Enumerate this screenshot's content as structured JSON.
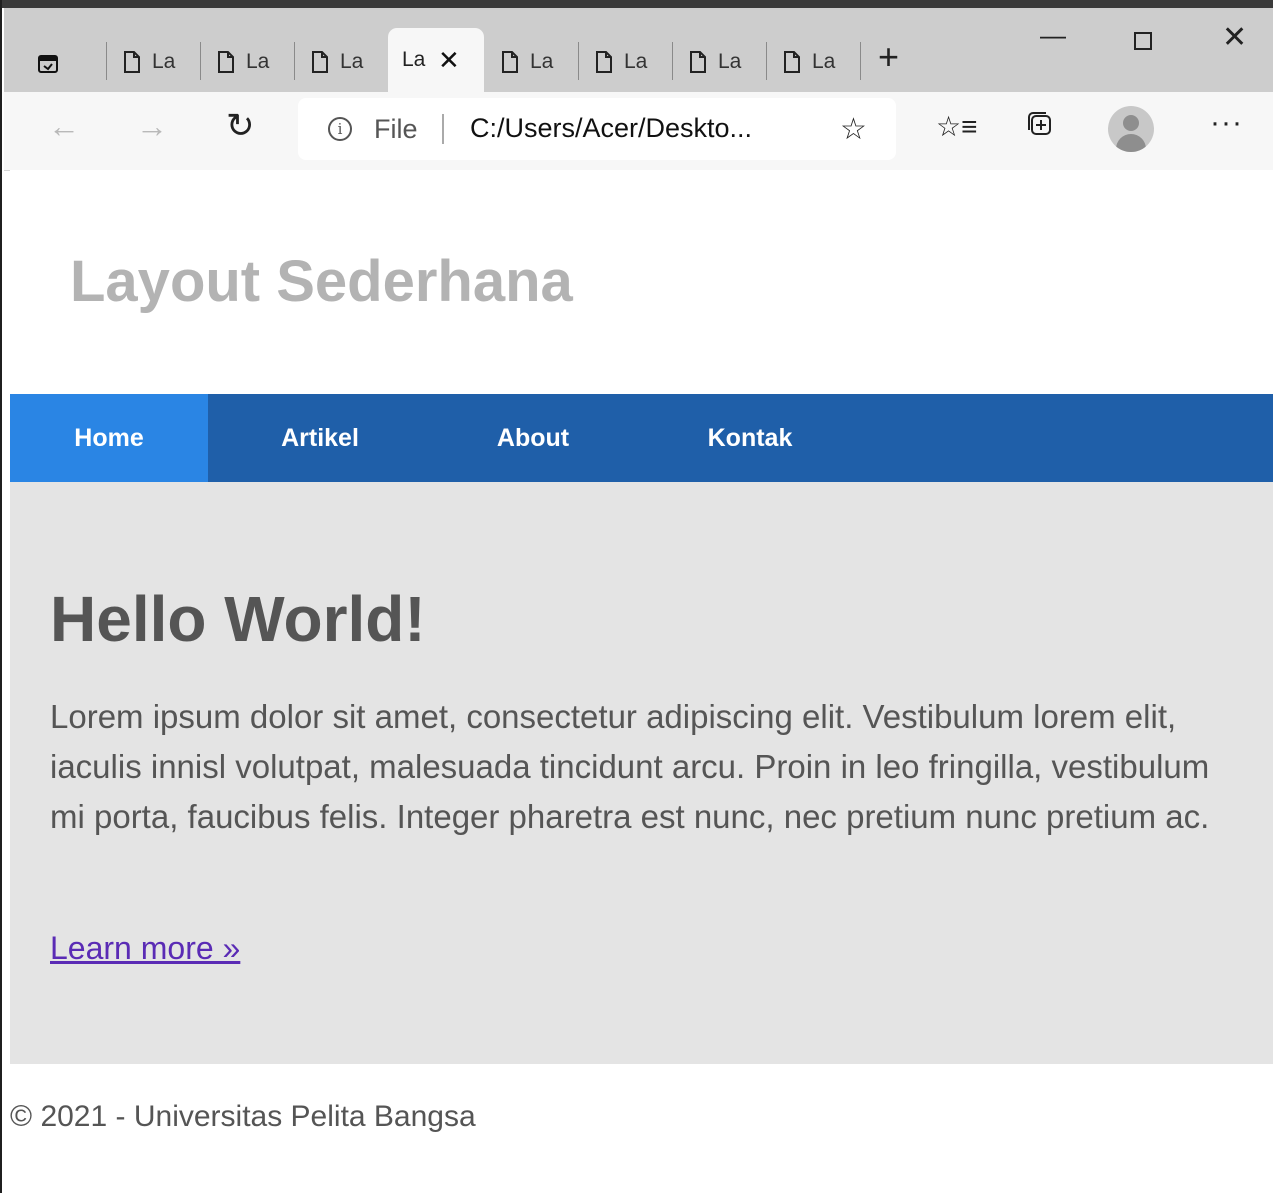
{
  "browser": {
    "tabs": [
      {
        "label": "La",
        "active": false
      },
      {
        "label": "La",
        "active": false
      },
      {
        "label": "La",
        "active": false
      },
      {
        "label": "La",
        "active": true
      },
      {
        "label": "La",
        "active": false
      },
      {
        "label": "La",
        "active": false
      },
      {
        "label": "La",
        "active": false
      },
      {
        "label": "La",
        "active": false
      }
    ],
    "new_tab_icon": "plus-icon",
    "window_controls": [
      "minimize-icon",
      "maximize-icon",
      "close-icon"
    ],
    "address": {
      "scheme": "File",
      "url": "C:/Users/Acer/Deskto..."
    },
    "toolbar_icons": [
      "back-icon",
      "forward-icon",
      "reload-icon",
      "add-favorite-icon",
      "favorites-icon",
      "collections-icon",
      "profile-icon",
      "more-icon"
    ]
  },
  "page": {
    "site_title": "Layout Sederhana",
    "nav": {
      "home": "Home",
      "artikel": "Artikel",
      "about": "About",
      "kontak": "Kontak"
    },
    "hero": {
      "heading": "Hello World!",
      "body": "Lorem ipsum dolor sit amet, consectetur adipiscing elit. Vestibulum lorem elit, iaculis innisl volutpat, malesuada tincidunt arcu. Proin in leo fringilla, vestibulum mi porta, faucibus felis. Integer pharetra est nunc, nec pretium nunc pretium ac.",
      "link": "Learn more »"
    },
    "footer": "© 2021 - Universitas Pelita Bangsa"
  },
  "colors": {
    "nav_bg": "#1f5fa9",
    "nav_active": "#2a85e4",
    "hero_bg": "#e4e4e4",
    "title_gray": "#b3b3b3",
    "text_gray": "#555555",
    "link": "#5a2bb5"
  }
}
